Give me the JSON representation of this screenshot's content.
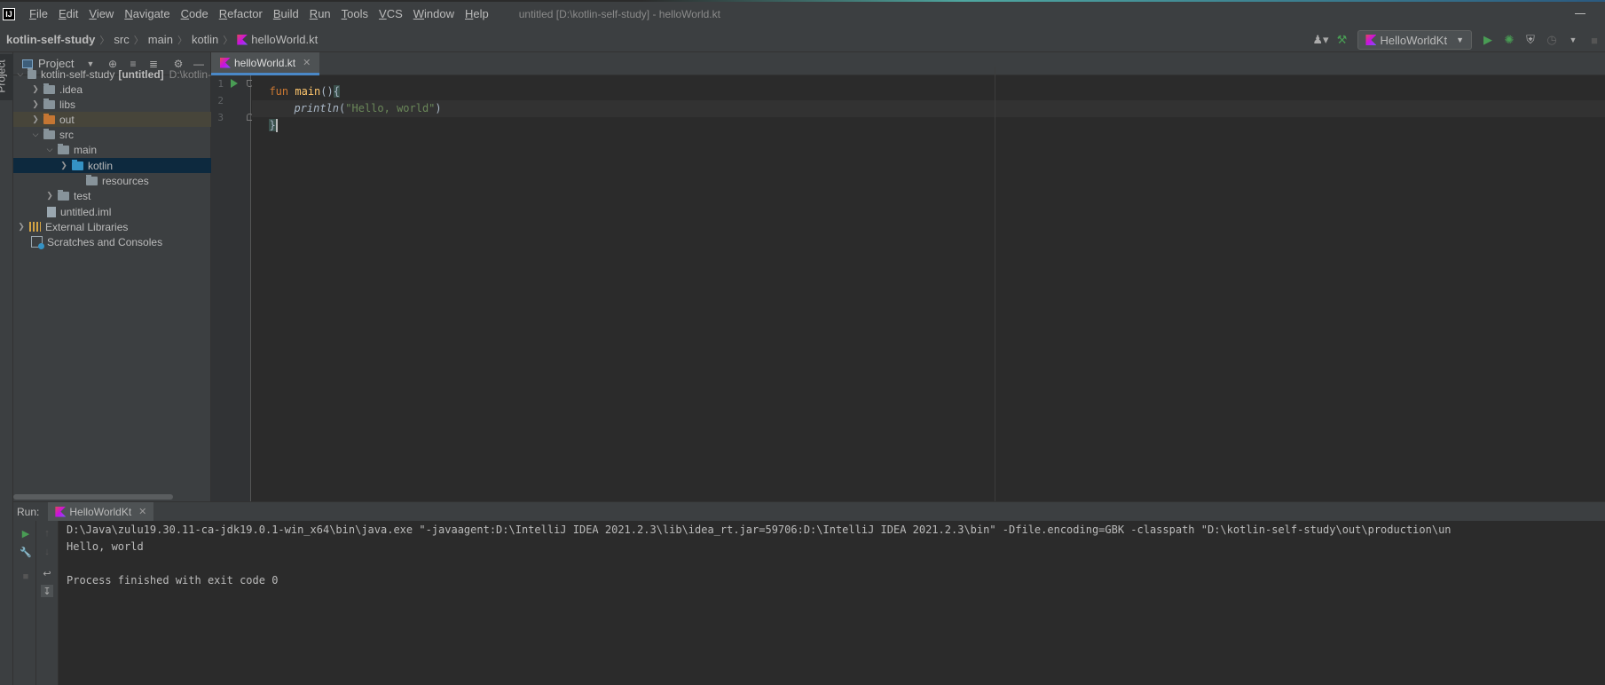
{
  "window": {
    "title": "untitled [D:\\kotlin-self-study] - helloWorld.kt",
    "app_icon": "IJ"
  },
  "menu": [
    "File",
    "Edit",
    "View",
    "Navigate",
    "Code",
    "Refactor",
    "Build",
    "Run",
    "Tools",
    "VCS",
    "Window",
    "Help"
  ],
  "breadcrumb": {
    "project": "kotlin-self-study",
    "parts": [
      "src",
      "main",
      "kotlin"
    ],
    "file": "helloWorld.kt"
  },
  "toolbar": {
    "run_config": "HelloWorldKt"
  },
  "left_stripe": {
    "project_tab": "Project"
  },
  "project_panel": {
    "title": "Project",
    "root": {
      "name": "kotlin-self-study",
      "module": "[untitled]",
      "path": "D:\\kotlin-"
    },
    "items": [
      {
        "label": ".idea"
      },
      {
        "label": "libs"
      },
      {
        "label": "out"
      },
      {
        "label": "src"
      },
      {
        "label": "main"
      },
      {
        "label": "kotlin"
      },
      {
        "label": "resources"
      },
      {
        "label": "test"
      },
      {
        "label": "untitled.iml"
      },
      {
        "label": "External Libraries"
      },
      {
        "label": "Scratches and Consoles"
      }
    ]
  },
  "editor": {
    "tab": "helloWorld.kt",
    "line_numbers": [
      "1",
      "2",
      "3"
    ],
    "lines": {
      "l1_kw": "fun",
      "l1_fn": "main",
      "l1_parens": "()",
      "l1_brace": "{",
      "l2_call": "println",
      "l2_open": "(",
      "l2_str": "\"Hello, world\"",
      "l2_close": ")",
      "l3_brace": "}"
    }
  },
  "run": {
    "label": "Run:",
    "tab": "HelloWorldKt",
    "console": [
      "D:\\Java\\zulu19.30.11-ca-jdk19.0.1-win_x64\\bin\\java.exe \"-javaagent:D:\\IntelliJ IDEA 2021.2.3\\lib\\idea_rt.jar=59706:D:\\IntelliJ IDEA 2021.2.3\\bin\" -Dfile.encoding=GBK -classpath \"D:\\kotlin-self-study\\out\\production\\un",
      "Hello, world",
      "",
      "Process finished with exit code 0"
    ]
  },
  "colors": {
    "accent": "#4a88c7",
    "run_green": "#499c54",
    "keyword": "#cc7832",
    "function": "#ffc66d",
    "string": "#6a8759"
  }
}
